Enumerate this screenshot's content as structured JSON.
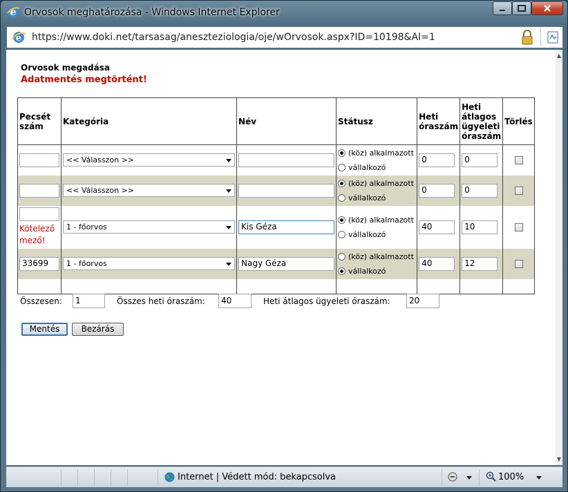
{
  "window": {
    "title": "Orvosok meghatározása - Windows Internet Explorer",
    "url": "https://www.doki.net/tarsasag/aneszteziologia/oje/wOrvosok.aspx?ID=10198&AI=1"
  },
  "page": {
    "section_title": "Orvosok megadása",
    "success_message": "Adatmentés megtörtént!"
  },
  "table": {
    "headers": {
      "pecset": "Pecsét szám",
      "kategoria": "Kategória",
      "nev": "Név",
      "statusz": "Státusz",
      "heti": "Heti óraszám",
      "atlag": "Heti átlagos ügyeleti óraszám",
      "torles": "Törlés"
    },
    "status_options": [
      "(köz) alkalmazott",
      "vállalkozó"
    ],
    "required_message": "Kötelező mező!",
    "rows": [
      {
        "pecset": "",
        "kategoria": "<< Válasszon >>",
        "nev": "",
        "status": "alkalmazott",
        "heti": "0",
        "atlag": "0"
      },
      {
        "pecset": "",
        "kategoria": "<< Válasszon >>",
        "nev": "",
        "status": "alkalmazott",
        "heti": "0",
        "atlag": "0"
      },
      {
        "pecset": "",
        "kategoria": "1 - főorvos",
        "nev": "Kis Géza",
        "status": "alkalmazott",
        "heti": "40",
        "atlag": "10"
      },
      {
        "pecset": "33699",
        "kategoria": "1 - főorvos",
        "nev": "Nagy Géza",
        "status": "vallalkozo",
        "heti": "40",
        "atlag": "12"
      }
    ]
  },
  "summary": {
    "total_label": "Összesen:",
    "total_value": "1",
    "weekly_label": "Összes heti óraszám:",
    "weekly_value": "40",
    "avg_label": "Heti átlagos ügyeleti óraszám:",
    "avg_value": "20"
  },
  "buttons": {
    "save": "Mentés",
    "close": "Bezárás"
  },
  "statusbar": {
    "zone_text": "Internet | Védett mód: bekapcsolva",
    "zoom": "100%"
  },
  "colors": {
    "alert_red": "#cc0000",
    "row_alt": "#d9d6c4",
    "primary_button_border": "#3a6fb0"
  }
}
